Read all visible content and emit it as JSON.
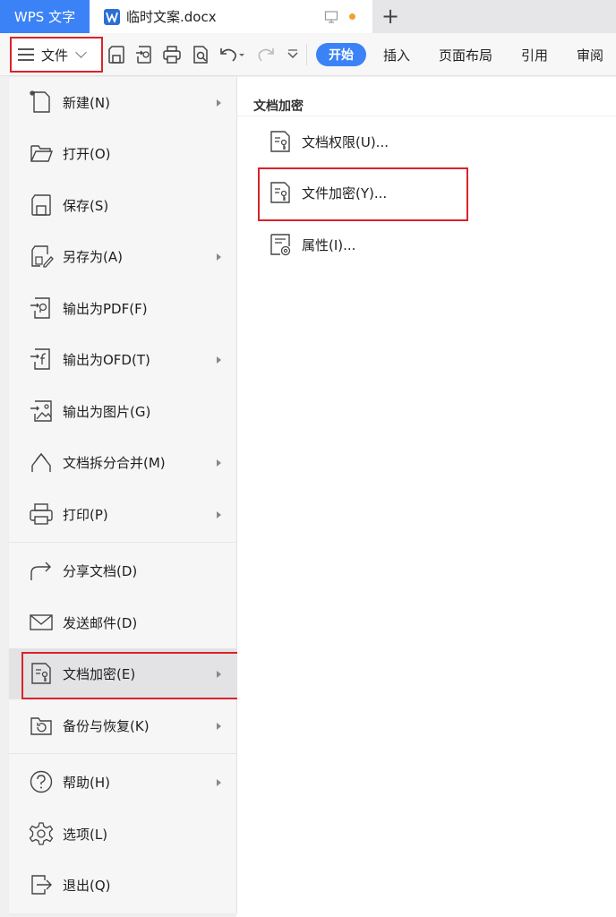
{
  "titlebar": {
    "app_tab": "WPS 文字",
    "doc_tab_title": "临时文案.docx"
  },
  "toolbar": {
    "file_label": "文件",
    "ribbon_tabs": [
      "开始",
      "插入",
      "页面布局",
      "引用",
      "审阅"
    ]
  },
  "menu": {
    "items": [
      {
        "label": "新建(N)",
        "icon": "new-doc-icon",
        "submenu": true
      },
      {
        "label": "打开(O)",
        "icon": "folder-open-icon",
        "submenu": false
      },
      {
        "label": "保存(S)",
        "icon": "save-icon",
        "submenu": false
      },
      {
        "label": "另存为(A)",
        "icon": "save-as-icon",
        "submenu": true
      },
      {
        "label": "输出为PDF(F)",
        "icon": "export-pdf-icon",
        "submenu": false
      },
      {
        "label": "输出为OFD(T)",
        "icon": "export-ofd-icon",
        "submenu": true
      },
      {
        "label": "输出为图片(G)",
        "icon": "export-image-icon",
        "submenu": false
      },
      {
        "label": "文档拆分合并(M)",
        "icon": "split-merge-icon",
        "submenu": true
      },
      {
        "label": "打印(P)",
        "icon": "print-icon",
        "submenu": true
      },
      {
        "label": "分享文档(D)",
        "icon": "share-icon",
        "submenu": false
      },
      {
        "label": "发送邮件(D)",
        "icon": "mail-icon",
        "submenu": false
      },
      {
        "label": "文档加密(E)",
        "icon": "doc-lock-icon",
        "submenu": true
      },
      {
        "label": "备份与恢复(K)",
        "icon": "backup-icon",
        "submenu": true
      },
      {
        "label": "帮助(H)",
        "icon": "help-icon",
        "submenu": true
      },
      {
        "label": "选项(L)",
        "icon": "gear-icon",
        "submenu": false
      },
      {
        "label": "退出(Q)",
        "icon": "exit-icon",
        "submenu": false
      }
    ]
  },
  "submenu": {
    "title": "文档加密",
    "items": [
      {
        "label": "文档权限(U)...",
        "icon": "doc-permission-icon"
      },
      {
        "label": "文件加密(Y)...",
        "icon": "file-encrypt-icon"
      },
      {
        "label": "属性(I)...",
        "icon": "properties-icon"
      }
    ]
  },
  "colors": {
    "accent": "#3b82f6",
    "highlight_border": "#d9232a",
    "active_item_bg": "#e3e3e5"
  }
}
